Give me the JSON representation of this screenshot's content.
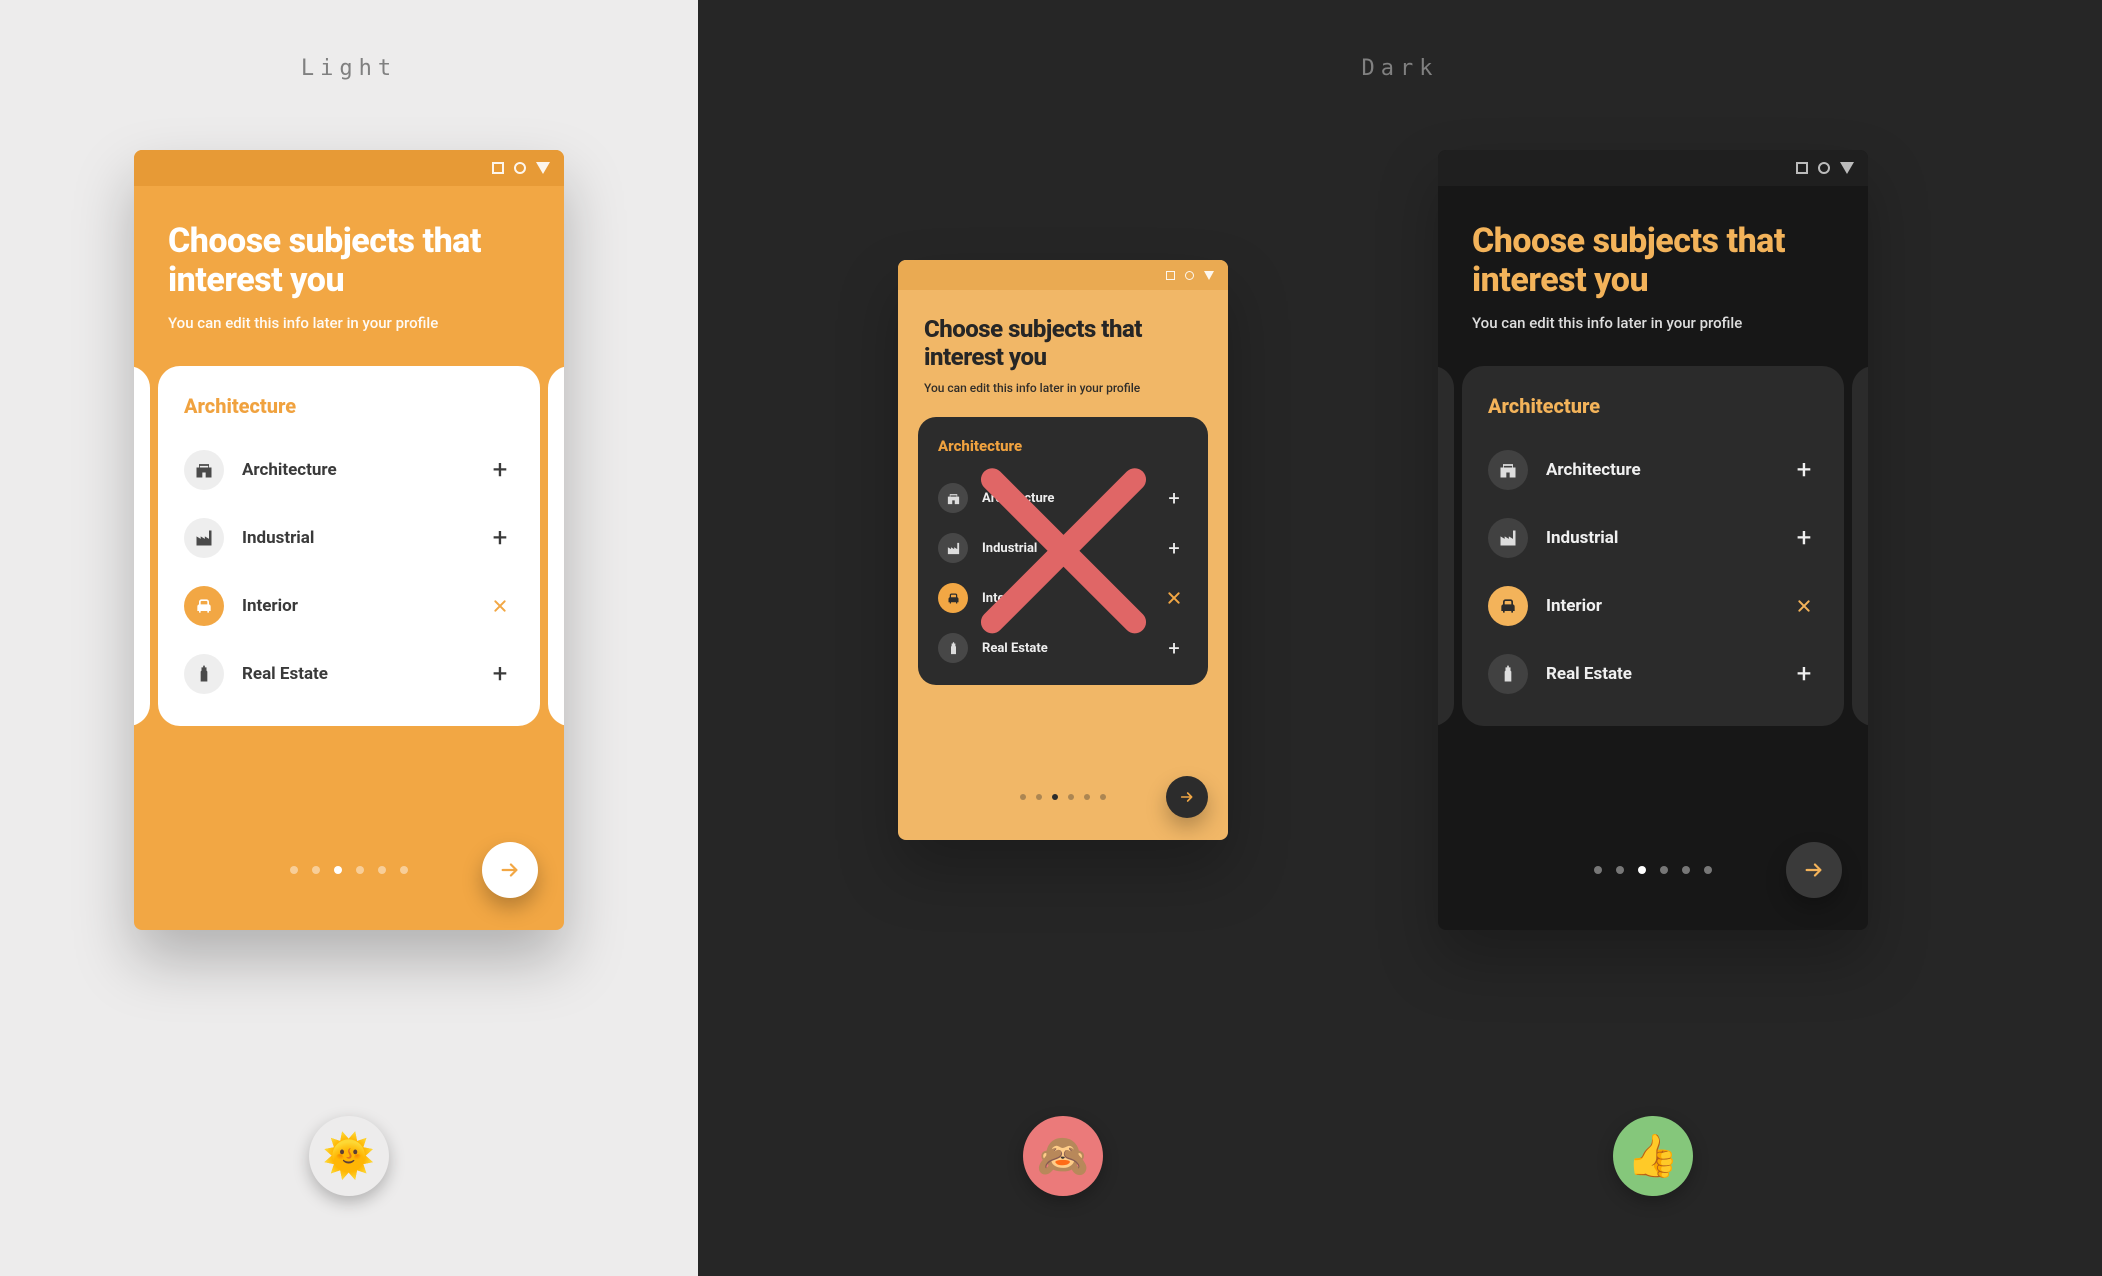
{
  "labels": {
    "light": "Light",
    "dark": "Dark"
  },
  "screen": {
    "title": "Choose subjects that interest you",
    "subtitle": "You can edit this info later in your profile",
    "category": "Architecture",
    "items": [
      {
        "id": "architecture",
        "label": "Architecture",
        "icon": "arch-icon",
        "selected": false
      },
      {
        "id": "industrial",
        "label": "Industrial",
        "icon": "factory-icon",
        "selected": false
      },
      {
        "id": "interior",
        "label": "Interior",
        "icon": "armchair-icon",
        "selected": true
      },
      {
        "id": "realestate",
        "label": "Real Estate",
        "icon": "tower-icon",
        "selected": false
      }
    ],
    "pager": {
      "count": 6,
      "active_index": 2
    }
  },
  "colors": {
    "accent": "#f2a744",
    "accent_dark_text": "#f3b35a",
    "dark_bg": "#262626",
    "light_bg": "#edecec"
  },
  "reactions": {
    "light": {
      "emoji": "🌞",
      "bg": "transparent"
    },
    "bad": {
      "emoji": "🙈",
      "bg": "#eb7a7a"
    },
    "good": {
      "emoji": "👍",
      "bg": "#85c77b"
    }
  },
  "icons": {
    "add": "plus-icon",
    "remove": "close-icon",
    "next": "arrow-right-icon",
    "window_controls": [
      "square-icon",
      "circle-icon",
      "triangle-down-icon"
    ]
  }
}
